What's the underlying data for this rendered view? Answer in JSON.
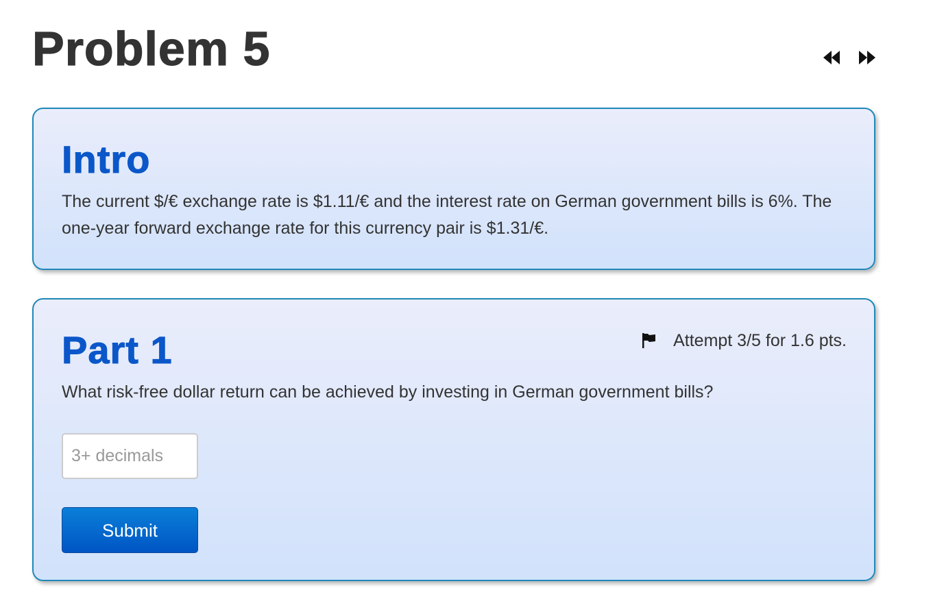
{
  "header": {
    "title": "Problem 5",
    "nav": {
      "prev_icon": "fast-backward-icon",
      "next_icon": "fast-forward-icon"
    }
  },
  "intro": {
    "heading": "Intro",
    "text": "The current $/€ exchange rate is $1.11/€ and the interest rate on German government bills is 6%. The one-year forward exchange rate for this currency pair is $1.31/€."
  },
  "part1": {
    "heading": "Part 1",
    "flag_icon": "flag-icon",
    "attempt": "Attempt 3/5 for 1.6 pts.",
    "question": "What risk-free dollar return can be achieved by investing in German government bills?",
    "answer": {
      "value": "",
      "placeholder": "3+ decimals"
    },
    "submit_label": "Submit"
  },
  "colors": {
    "heading_blue": "#0b57c9",
    "card_border": "#1f88b8",
    "button_blue": "#0055c4",
    "text": "#333333"
  }
}
